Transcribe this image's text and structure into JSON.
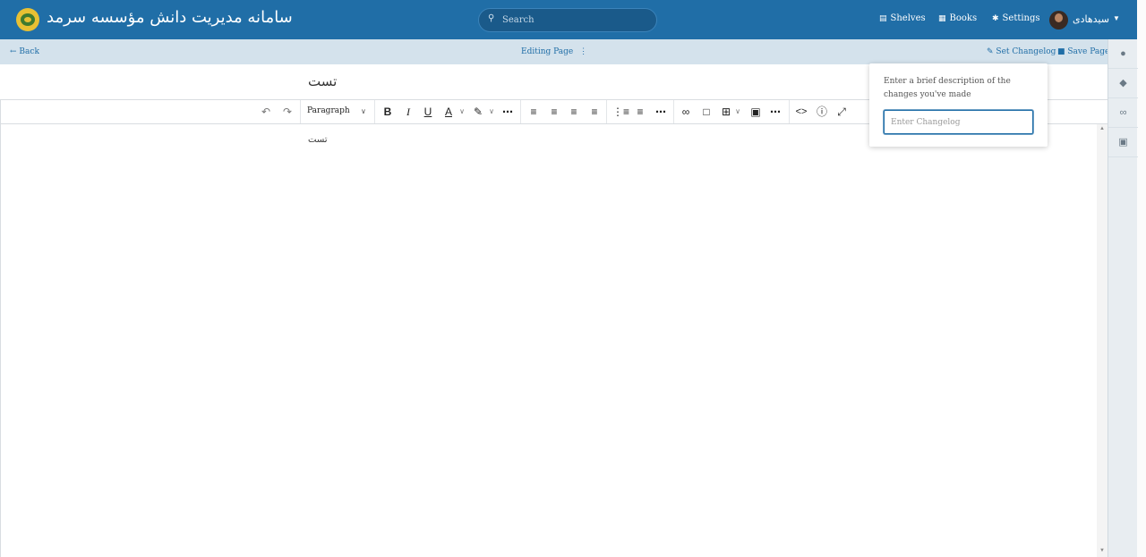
{
  "header": {
    "title": "سامانه مدیریت دانش مؤسسه سرمد",
    "search_placeholder": "Search",
    "nav": [
      {
        "label": "Shelves",
        "icon": "shelves-icon"
      },
      {
        "label": "Books",
        "icon": "books-icon"
      },
      {
        "label": "Settings",
        "icon": "gear-icon"
      }
    ],
    "username": "سیدهادی"
  },
  "editbar": {
    "back_label": "Back",
    "editing_label": "Editing Page",
    "set_changelog_label": "Set Changelog",
    "save_page_label": "Save Page"
  },
  "page": {
    "title": "تست",
    "body": "تست"
  },
  "toolbar": {
    "format_label": "Paragraph"
  },
  "changelog_popup": {
    "description": "Enter a brief description of the changes you've made",
    "input_placeholder": "Enter Changelog"
  },
  "colors": {
    "header": "#206ea7",
    "editbar": "#d4e2ec",
    "accent": "#206ea7"
  }
}
